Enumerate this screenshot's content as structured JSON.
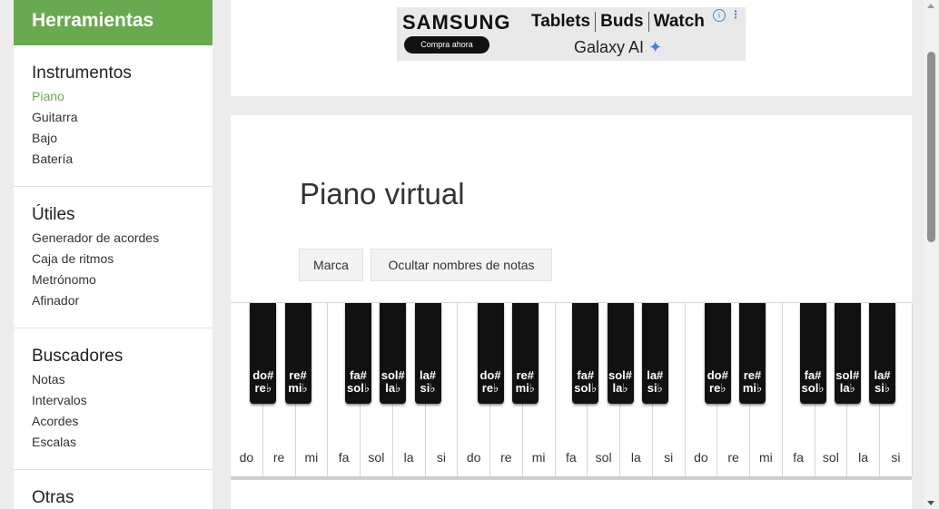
{
  "sidebar": {
    "header": "Herramientas",
    "sections": [
      {
        "title": "Instrumentos",
        "items": [
          "Piano",
          "Guitarra",
          "Bajo",
          "Batería"
        ]
      },
      {
        "title": "Útiles",
        "items": [
          "Generador de acordes",
          "Caja de ritmos",
          "Metrónomo",
          "Afinador"
        ]
      },
      {
        "title": "Buscadores",
        "items": [
          "Notas",
          "Intervalos",
          "Acordes",
          "Escalas"
        ]
      },
      {
        "title": "Otras"
      }
    ],
    "active_item": "Piano",
    "accent_color": "#6aaa4f"
  },
  "ad": {
    "brand": "SAMSUNG",
    "cta": "Compra ahora",
    "products": [
      "Tablets",
      "Buds",
      "Watch"
    ],
    "tagline": "Galaxy AI",
    "sparkle_icon": "✦",
    "info_icon": "i",
    "menu_icon": "⋮"
  },
  "main": {
    "title": "Piano virtual",
    "buttons": {
      "mark": "Marca",
      "hide_notes": "Ocultar nombres de notas"
    }
  },
  "piano": {
    "white_keys": [
      "do",
      "re",
      "mi",
      "fa",
      "sol",
      "la",
      "si",
      "do",
      "re",
      "mi",
      "fa",
      "sol",
      "la",
      "si",
      "do",
      "re",
      "mi",
      "fa",
      "sol",
      "la",
      "si"
    ],
    "black_keys": [
      [
        "do#",
        "re♭"
      ],
      [
        "re#",
        "mi♭"
      ],
      [
        "fa#",
        "sol♭"
      ],
      [
        "sol#",
        "la♭"
      ],
      [
        "la#",
        "si♭"
      ],
      [
        "do#",
        "re♭"
      ],
      [
        "re#",
        "mi♭"
      ],
      [
        "fa#",
        "sol♭"
      ],
      [
        "sol#",
        "la♭"
      ],
      [
        "la#",
        "si♭"
      ],
      [
        "do#",
        "re♭"
      ],
      [
        "re#",
        "mi♭"
      ],
      [
        "fa#",
        "sol♭"
      ],
      [
        "sol#",
        "la♭"
      ],
      [
        "la#",
        "si♭"
      ]
    ]
  }
}
